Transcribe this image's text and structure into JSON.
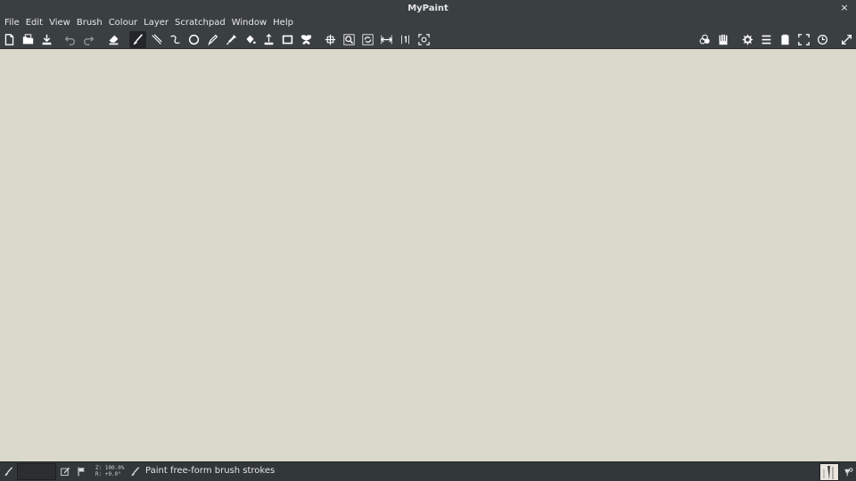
{
  "window": {
    "title": "MyPaint",
    "close_glyph": "×"
  },
  "menu": [
    "File",
    "Edit",
    "View",
    "Brush",
    "Colour",
    "Layer",
    "Scratchpad",
    "Window",
    "Help"
  ],
  "toolbar": {
    "left_icons": [
      "new-document-icon",
      "open-document-icon",
      "save-document-icon",
      "undo-icon",
      "redo-icon",
      "eraser-icon",
      "freehand-brush-icon",
      "lines-curves-icon",
      "connected-lines-icon",
      "ellipse-icon",
      "inking-icon",
      "colour-picker-icon",
      "flood-fill-icon",
      "layer-move-icon",
      "frame-icon",
      "symmetry-icon",
      "pan-icon",
      "zoom-icon",
      "rotate-icon",
      "flip-icon",
      "reset-zoom-icon",
      "fit-view-icon"
    ],
    "right_icons": [
      "colour-palette-icon",
      "brush-groups-icon",
      "settings-gear-icon",
      "main-menu-icon",
      "scratchpad-icon",
      "fullscreen-icon",
      "history-icon",
      "expand-icon"
    ],
    "active_tool": "freehand-brush-icon"
  },
  "canvas": {
    "background": "#dbd8cc"
  },
  "status": {
    "zoom_line": "Z: 100.0%",
    "rotation_line": "R: +0.0°",
    "message": "Paint free-form brush strokes"
  },
  "colors": {
    "chrome": "#3a3f42",
    "statusbar": "#32373a",
    "canvas": "#dbd8cc"
  }
}
